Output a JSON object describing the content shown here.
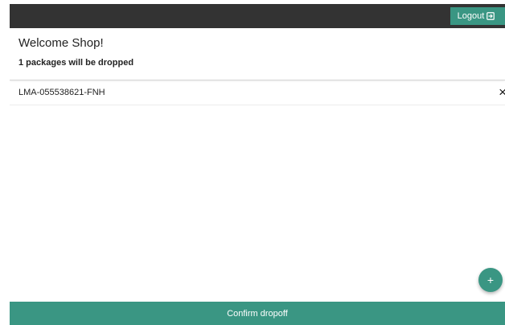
{
  "topbar": {
    "logout_label": "Logout",
    "logout_icon": "logout-icon"
  },
  "header": {
    "welcome": "Welcome Shop!",
    "count_text": "1 packages will be dropped"
  },
  "packages": [
    {
      "code": "LMA-055538621-FNH",
      "remove_symbol": "×"
    }
  ],
  "fab": {
    "symbol": "+"
  },
  "footer": {
    "confirm_label": "Confirm dropoff"
  },
  "colors": {
    "topbar": "#333333",
    "accent": "#3a9683",
    "text": "#222222"
  }
}
